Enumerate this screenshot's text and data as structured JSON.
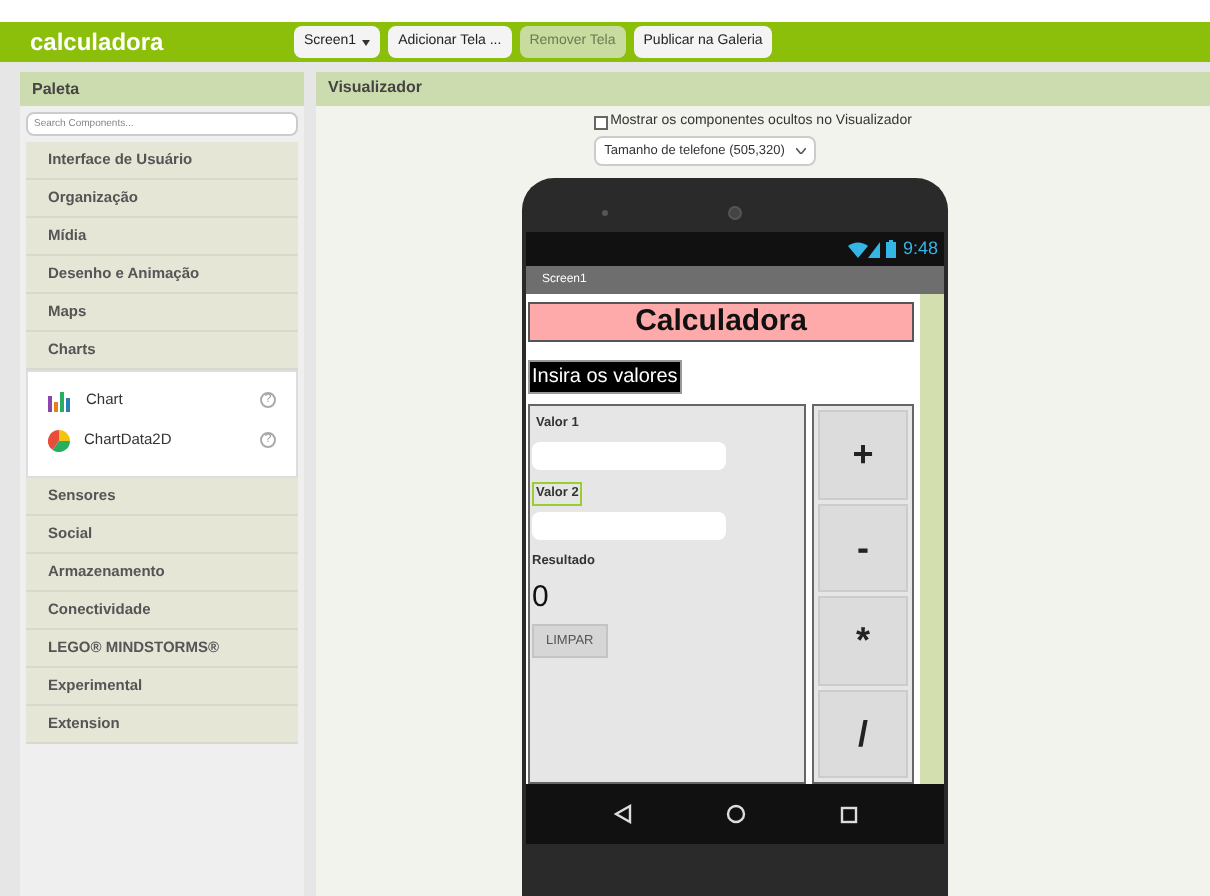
{
  "app_title": "calculadora",
  "toolbar": [
    {
      "label": "Screen1",
      "kind": "dropdown",
      "disabled": false
    },
    {
      "label": "Adicionar Tela ...",
      "kind": "button",
      "disabled": false
    },
    {
      "label": "Remover Tela",
      "kind": "button",
      "disabled": true
    },
    {
      "label": "Publicar na Galeria",
      "kind": "button",
      "disabled": false
    }
  ],
  "palette": {
    "title": "Paleta",
    "search": {
      "placeholder": "Search Components..."
    },
    "categories": [
      {
        "label": "Interface de Usuário"
      },
      {
        "label": "Organização"
      },
      {
        "label": "Mídia"
      },
      {
        "label": "Desenho e Animação"
      },
      {
        "label": "Maps"
      },
      {
        "label": "Charts",
        "children": [
          {
            "label": "Chart",
            "kind": "bar",
            "help": "?"
          },
          {
            "label": "ChartData2D",
            "kind": "pie",
            "help": "?"
          }
        ]
      },
      {
        "label": "Sensores"
      },
      {
        "label": "Social"
      },
      {
        "label": "Armazenamento"
      },
      {
        "label": "Conectividade"
      },
      {
        "label": "LEGO® MINDSTORMS®"
      },
      {
        "label": "Experimental"
      },
      {
        "label": "Extension"
      }
    ]
  },
  "viewer": {
    "title": "Visualizador",
    "show_hidden": {
      "label": "Mostrar os componentes ocultos no Visualizador",
      "checked": false
    },
    "size_select": {
      "value": "Tamanho de telefone (505,320)"
    },
    "phone": {
      "time": "9:48",
      "screen_title": "Screen1",
      "heading": "Calculadora",
      "prompt": "Insira os valores",
      "fields": [
        {
          "label": "Valor 1",
          "selected": false
        },
        {
          "label": "Valor 2",
          "selected": true
        }
      ],
      "result_label": "Resultado",
      "result": "0",
      "clear_button": "LIMPAR",
      "operators": [
        "+",
        "-",
        "*",
        "/"
      ]
    }
  }
}
